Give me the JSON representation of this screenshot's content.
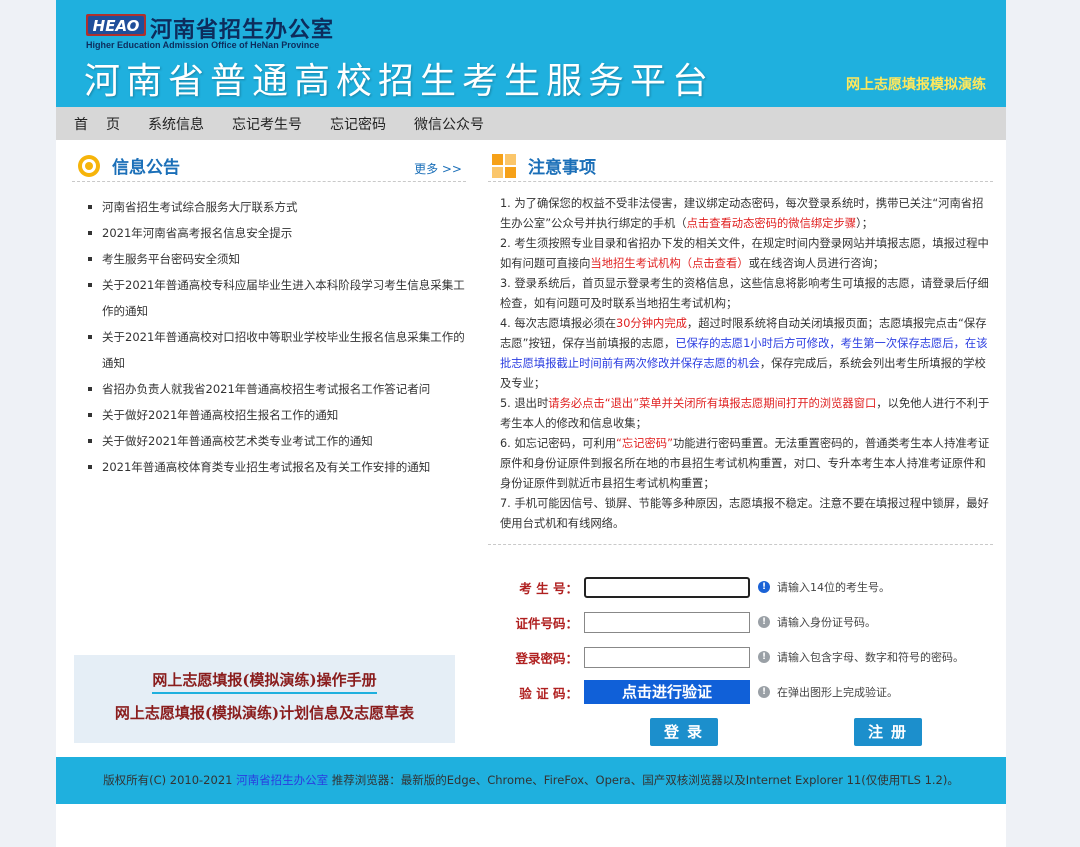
{
  "header": {
    "logo_text": "HEAO",
    "org_cn": "河南省招生办公室",
    "org_en": "Higher Education Admission Office of HeNan Province",
    "platform_title": "河南省普通高校招生考生服务平台",
    "sub_badge": "网上志愿填报模拟演练",
    "banner_color": "#1fb0de"
  },
  "nav": {
    "items": [
      "首页",
      "系统信息",
      "忘记考生号",
      "忘记密码",
      "微信公众号"
    ]
  },
  "notices": {
    "title": "信息公告",
    "more": "更多 >>",
    "items": [
      "河南省招生考试综合服务大厅联系方式",
      "2021年河南省高考报名信息安全提示",
      "考生服务平台密码安全须知",
      "关于2021年普通高校专科应届毕业生进入本科阶段学习考生信息采集工作的通知",
      "关于2021年普通高校对口招收中等职业学校毕业生报名信息采集工作的通知",
      "省招办负责人就我省2021年普通高校招生考试报名工作答记者问",
      "关于做好2021年普通高校招生报名工作的通知",
      "关于做好2021年普通高校艺术类专业考试工作的通知",
      "2021年普通高校体育类专业招生考试报名及有关工作安排的通知"
    ]
  },
  "manuals": {
    "manual_link": "网上志愿填报(模拟演练)操作手册",
    "plan_link": "网上志愿填报(模拟演练)计划信息及志愿草表"
  },
  "notes": {
    "title": "注意事项",
    "n1_a": "1. 为了确保您的权益不受非法侵害，建议绑定动态密码，每次登录系统时，携带已关注“河南省招生办公室”公众号并执行绑定的手机（",
    "n1_red": "点击查看动态密码的微信绑定步骤",
    "n1_b": "）；",
    "n2_a": "2. 考生须按照专业目录和省招办下发的相关文件，在规定时间内登录网站并填报志愿，填报过程中如有问题可直接向",
    "n2_red": "当地招生考试机构（点击查看）",
    "n2_b": "或在线咨询人员进行咨询；",
    "n3": "3. 登录系统后，首页显示登录考生的资格信息，这些信息将影响考生可填报的志愿，请登录后仔细检查，如有问题可及时联系当地招生考试机构；",
    "n4_a": "4. 每次志愿填报必须在",
    "n4_red1": "30分钟内完成",
    "n4_b": "，超过时限系统将自动关闭填报页面；志愿填报完点击“保存志愿”按钮，保存当前填报的志愿，",
    "n4_blue": "已保存的志愿1小时后方可修改，考生第一次保存志愿后，在该批志愿填报截止时间前有两次修改并保存志愿的机会",
    "n4_c": "，保存完成后，系统会列出考生所填报的学校及专业；",
    "n5_a": "5. 退出时",
    "n5_red": "请务必点击“退出”菜单并关闭所有填报志愿期间打开的浏览器窗口",
    "n5_b": "，以免他人进行不利于考生本人的修改和信息收集；",
    "n6_a": "6. 如忘记密码，可利用",
    "n6_red": "“忘记密码”",
    "n6_b": "功能进行密码重置。无法重置密码的，普通类考生本人持准考证原件和身份证原件到报名所在地的市县招生考试机构重置，对口、专升本考生本人持准考证原件和身份证原件到就近市县招生考试机构重置；",
    "n7": "7. 手机可能因信号、锁屏、节能等多种原因，志愿填报不稳定。注意不要在填报过程中锁屏，最好使用台式机和有线网络。"
  },
  "login": {
    "exam_label": "考 生 号：",
    "exam_hint": "请输入14位的考生号。",
    "id_label": "证件号码：",
    "id_hint": "请输入身份证号码。",
    "pwd_label": "登录密码：",
    "pwd_hint": "请输入包含字母、数字和符号的密码。",
    "captcha_label": "验 证 码：",
    "captcha_button": "点击进行验证",
    "captcha_hint": "在弹出图形上完成验证。",
    "login_button": "登录",
    "register_button": "注册"
  },
  "footer": {
    "copyright": "版权所有(C) 2010-2021 ",
    "org_link": "河南省招生办公室",
    "browsers": "  推荐浏览器：最新版的Edge、Chrome、FireFox、Opera、国产双核浏览器以及Internet Explorer 11(仅使用TLS 1.2)。"
  }
}
